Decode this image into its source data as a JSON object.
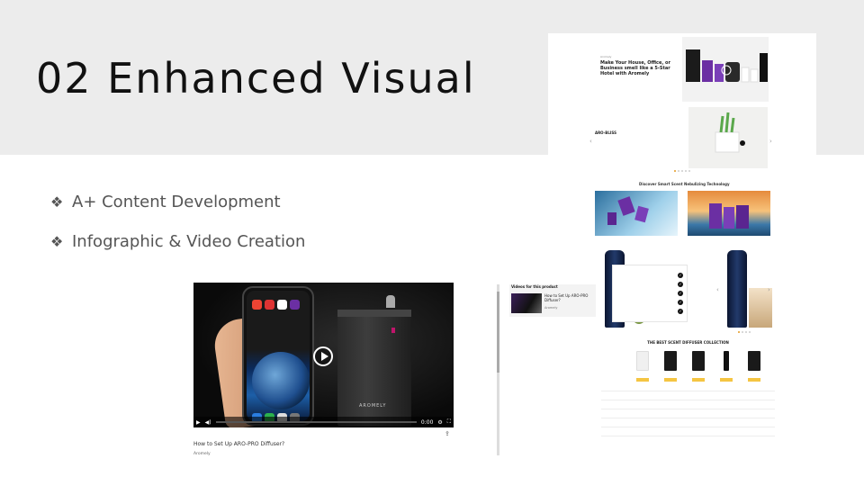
{
  "slide": {
    "title": "02 Enhanced Visual",
    "bullets": [
      "A+ Content Development",
      "Infographic & Video Creation"
    ],
    "bullet_icon": "four-diamond-icon"
  },
  "video": {
    "title": "How to Set Up ARO-PRO Diffuser?",
    "brand": "Aromely",
    "device_logo": "AROMELY",
    "time": "0:00",
    "progress": 0,
    "list_heading": "Videos for this product",
    "list_item_title": "How to Set Up ARO-PRO Diffuser?",
    "list_item_author": "Aromely"
  },
  "product_page": {
    "headline": "Make Your House, Office, or Business smell like a 5-Star Hotel with Aromely",
    "section": "ARO-BLISS",
    "brand": "Aromely"
  },
  "sections": {
    "discover_title": "Discover Smart Scent Nebulizing Technology",
    "compare_title": "THE BEST SCENT DIFFUSER COLLECTION"
  },
  "colors": {
    "header_bg": "#ececec",
    "accent_purple": "#6b2fa3",
    "accent_orange": "#e59a22"
  }
}
